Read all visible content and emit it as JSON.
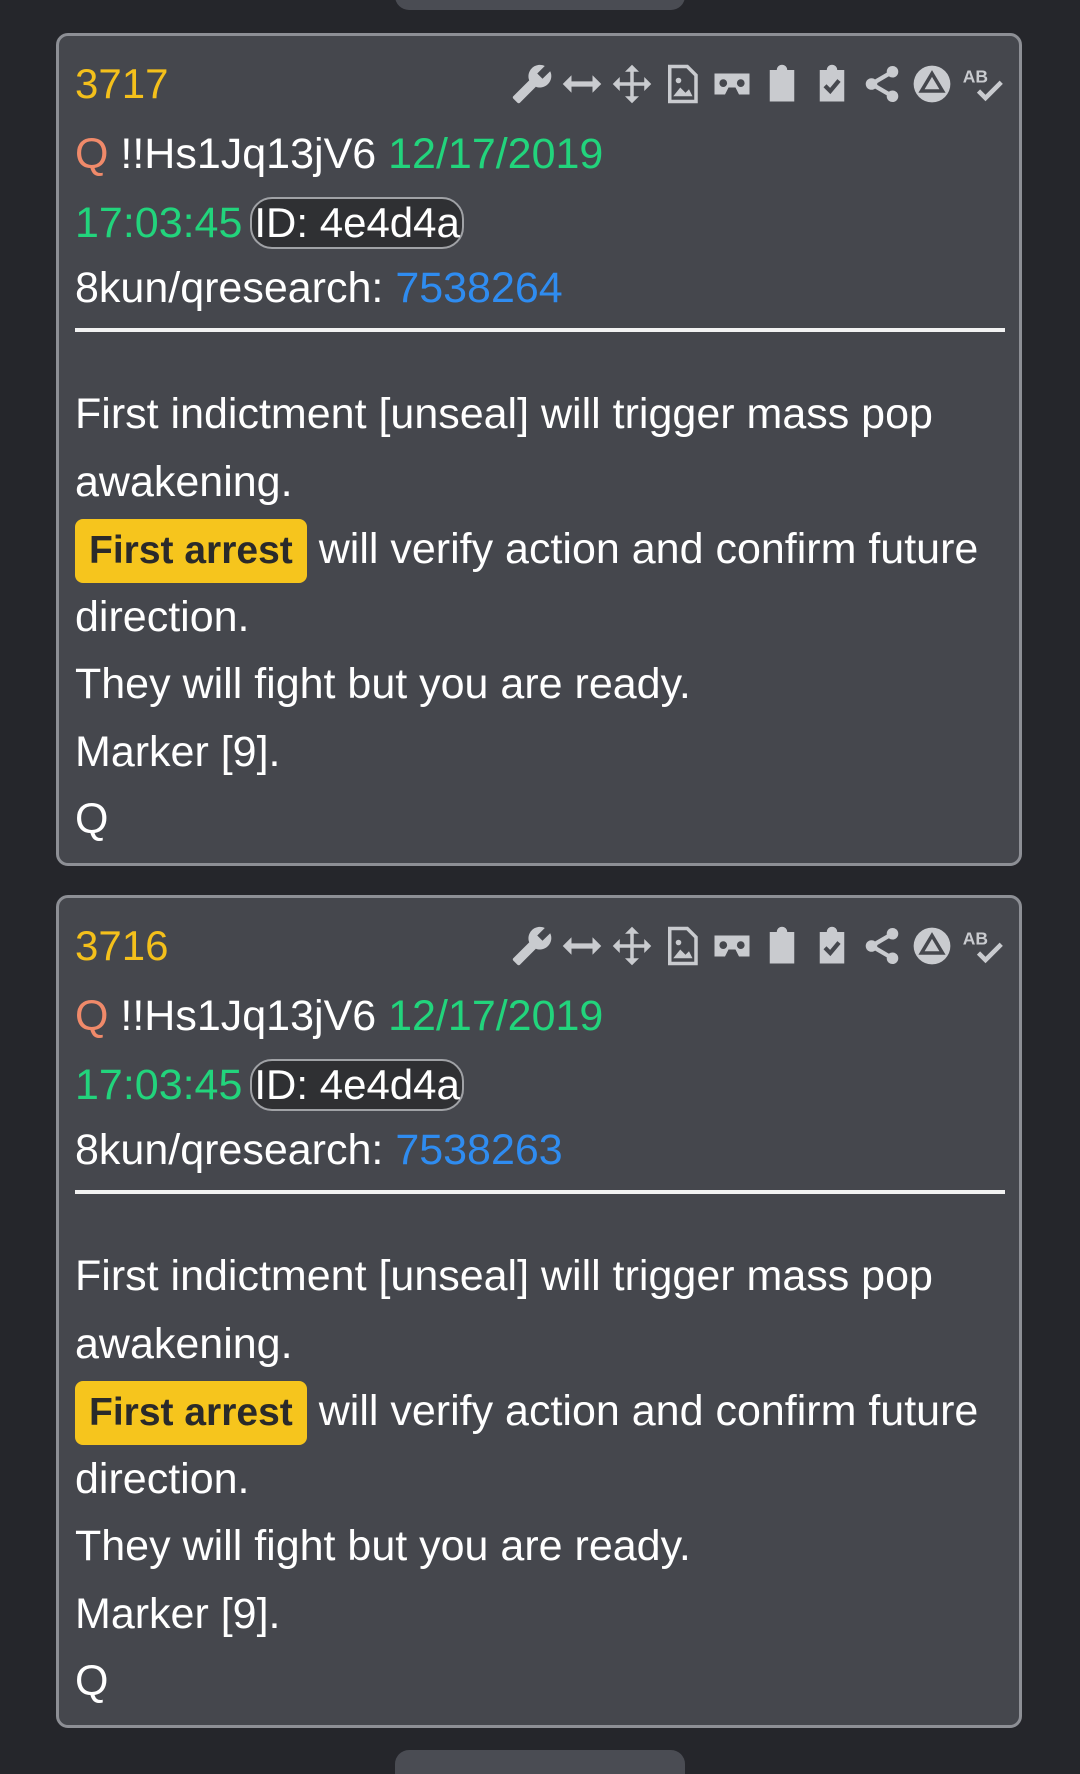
{
  "posts": [
    {
      "number": "3717",
      "author": "Q",
      "tripcode": "!!Hs1Jq13jV6",
      "date": "12/17/2019",
      "time": "17:03:45",
      "id": "ID: 4e4d4a",
      "board": "8kun/qresearch:",
      "post_ref": "7538264",
      "lines": [
        "First indictment [unseal] will trigger mass pop awakening.",
        "will verify action and confirm future direction.",
        "They will fight but you are ready.",
        "Marker [9].",
        "Q"
      ],
      "highlight": "First arrest"
    },
    {
      "number": "3716",
      "author": "Q",
      "tripcode": "!!Hs1Jq13jV6",
      "date": "12/17/2019",
      "time": "17:03:45",
      "id": "ID: 4e4d4a",
      "board": "8kun/qresearch:",
      "post_ref": "7538263",
      "lines": [
        "First indictment [unseal] will trigger mass pop awakening.",
        "will verify action and confirm future direction.",
        "They will fight but you are ready.",
        "Marker [9].",
        "Q"
      ],
      "highlight": "First arrest"
    }
  ],
  "toolbar_icons": [
    "wrench-icon",
    "resize-horizontal-icon",
    "move-icon",
    "image-file-icon",
    "vr-headset-icon",
    "clipboard-icon",
    "clipboard-check-icon",
    "share-icon",
    "triangle-circle-icon",
    "spellcheck-icon"
  ],
  "toolbar_text": {
    "spellcheck": "AB"
  },
  "colors": {
    "number": "#f4c01b",
    "date": "#22d47c",
    "author": "#f08a6a",
    "link": "#2f8cf0",
    "highlight": "#f6c51d"
  }
}
